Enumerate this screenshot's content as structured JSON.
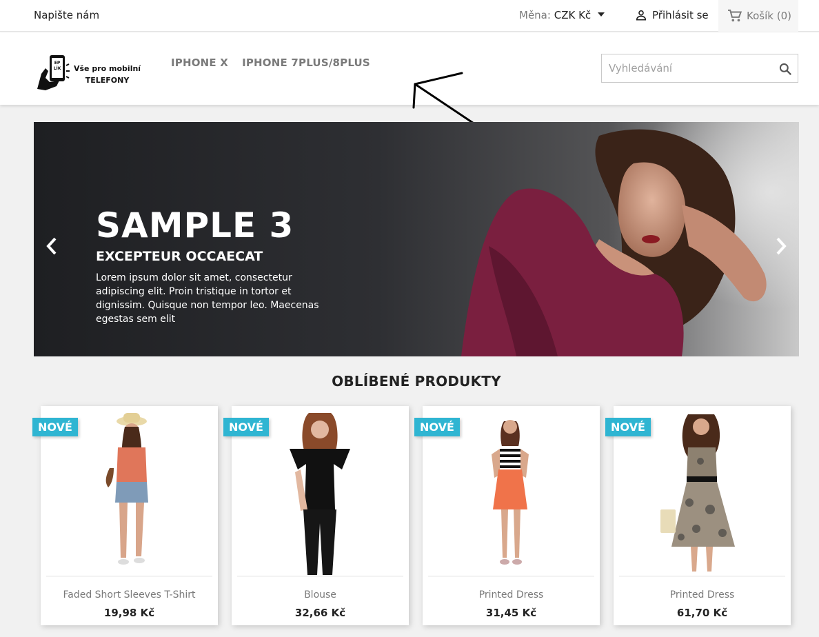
{
  "topbar": {
    "contact_label": "Napište nám",
    "currency_label": "Měna:",
    "currency_value": "CZK Kč",
    "login_label": "Přihlásit se",
    "cart_label": "Košík",
    "cart_count": "(0)"
  },
  "header": {
    "logo_line1": "Vše pro mobilní",
    "logo_line2": "TELEFONY",
    "logo_phone_text": "EP LÍK",
    "nav": [
      "IPHONE X",
      "IPHONE 7PLUS/8PLUS"
    ],
    "search_placeholder": "Vyhledávání"
  },
  "slider": {
    "title": "SAMPLE 3",
    "subtitle": "EXCEPTEUR OCCAECAT",
    "text": "Lorem ipsum dolor sit amet, consectetur adipiscing elit. Proin tristique in tortor et dignissim. Quisque non tempor leo. Maecenas egestas sem elit"
  },
  "featured": {
    "title": "OBLÍBENÉ PRODUKTY",
    "badge_label": "NOVÉ",
    "products": [
      {
        "name": "Faded Short Sleeves T-Shirt",
        "price": "19,98 Kč"
      },
      {
        "name": "Blouse",
        "price": "32,66 Kč"
      },
      {
        "name": "Printed Dress",
        "price": "31,45 Kč"
      },
      {
        "name": "Printed Dress",
        "price": "61,70 Kč"
      }
    ]
  },
  "colors": {
    "accent": "#2fb5d2",
    "text": "#232323",
    "muted": "#7a7a7a",
    "background": "#f1f1f1"
  }
}
